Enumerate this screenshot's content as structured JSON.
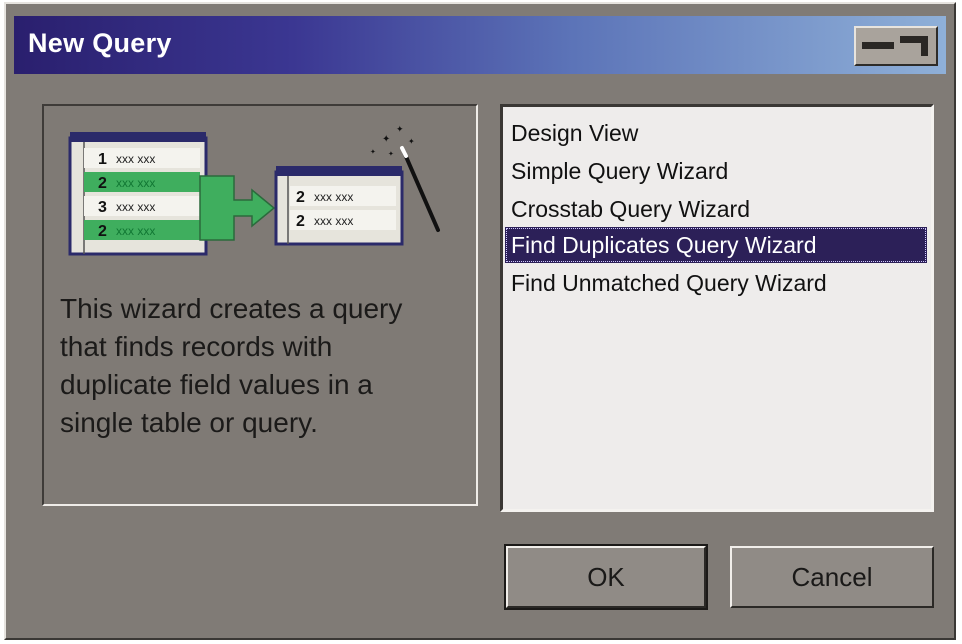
{
  "dialog": {
    "title": "New Query"
  },
  "preview": {
    "illustration": {
      "source_rows": [
        {
          "num": "1",
          "text": "xxx xxx"
        },
        {
          "num": "2",
          "text": "xxx xxx"
        },
        {
          "num": "3",
          "text": "xxx xxx"
        },
        {
          "num": "2",
          "text": "xxx xxx"
        }
      ],
      "result_rows": [
        {
          "num": "2",
          "text": "xxx xxx"
        },
        {
          "num": "2",
          "text": "xxx xxx"
        }
      ],
      "icons": [
        "table-icon",
        "arrow-icon",
        "magic-wand-icon"
      ]
    },
    "description": "This wizard creates a query that finds records with duplicate field values in a single table or query."
  },
  "query_types": {
    "items": [
      "Design View",
      "Simple Query Wizard",
      "Crosstab Query Wizard",
      "Find Duplicates Query Wizard",
      "Find Unmatched Query Wizard"
    ],
    "selected": "Find Duplicates Query Wizard"
  },
  "buttons": {
    "ok": "OK",
    "cancel": "Cancel"
  },
  "colors": {
    "title_bar_start": "#2a1f6e",
    "title_bar_end": "#8fb0d8",
    "selection": "#2c2058",
    "highlight_green": "#3fae5e",
    "dialog_face": "#807b76"
  }
}
